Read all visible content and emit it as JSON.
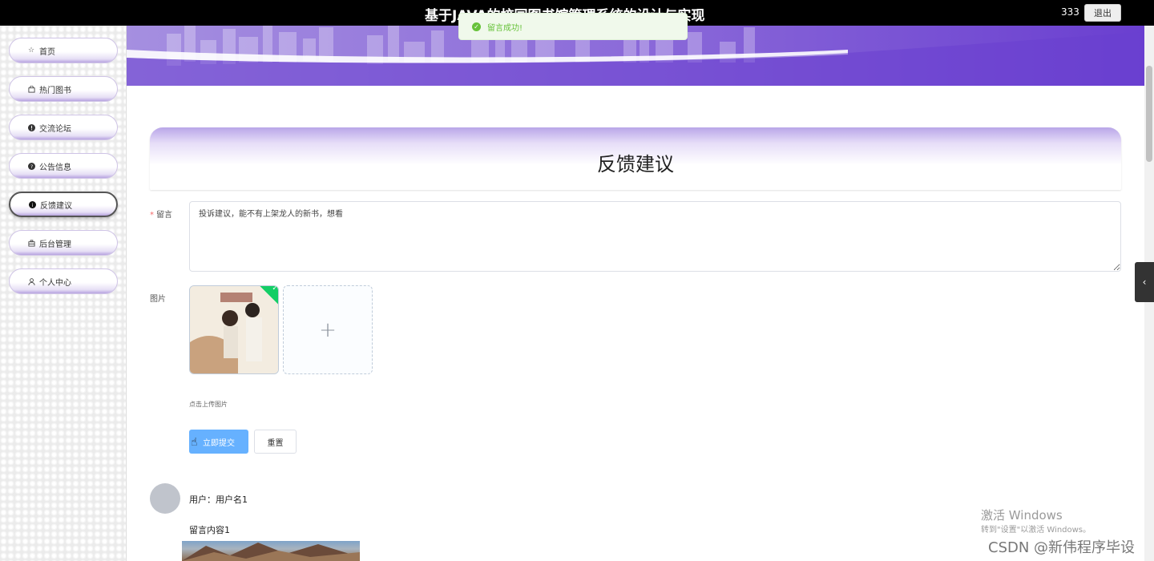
{
  "header": {
    "app_title": "基于JAVA的校园图书馆管理系统的设计与实现",
    "username": "333",
    "logout_label": "退出"
  },
  "toast": {
    "message": "留言成功!",
    "icon": "check-circle-icon",
    "color": "#67c23a"
  },
  "sidebar": {
    "items": [
      {
        "label": "首页",
        "icon": "star-icon"
      },
      {
        "label": "热门图书",
        "icon": "bag-icon"
      },
      {
        "label": "交流论坛",
        "icon": "alert-circle-icon"
      },
      {
        "label": "公告信息",
        "icon": "question-circle-icon"
      },
      {
        "label": "反馈建议",
        "icon": "info-circle-icon",
        "active": true
      },
      {
        "label": "后台管理",
        "icon": "briefcase-icon"
      },
      {
        "label": "个人中心",
        "icon": "user-icon"
      }
    ]
  },
  "page": {
    "title": "反馈建议"
  },
  "form": {
    "message_label": "留言",
    "message_value": "投诉建议，能不有上架龙人的新书，想看",
    "image_label": "图片",
    "upload_tip": "点击上传图片",
    "submit_label": "立即提交",
    "reset_label": "重置"
  },
  "comments": [
    {
      "user_prefix": "用户：",
      "user_name": "用户名1",
      "content": "留言内容1"
    }
  ],
  "watermarks": {
    "windows_title": "激活 Windows",
    "windows_sub": "转到\"设置\"以激活 Windows。",
    "csdn": "CSDN @新伟程序毕设"
  },
  "colors": {
    "accent": "#7b55d6",
    "primary_button": "#66b1ff",
    "success": "#67c23a"
  }
}
